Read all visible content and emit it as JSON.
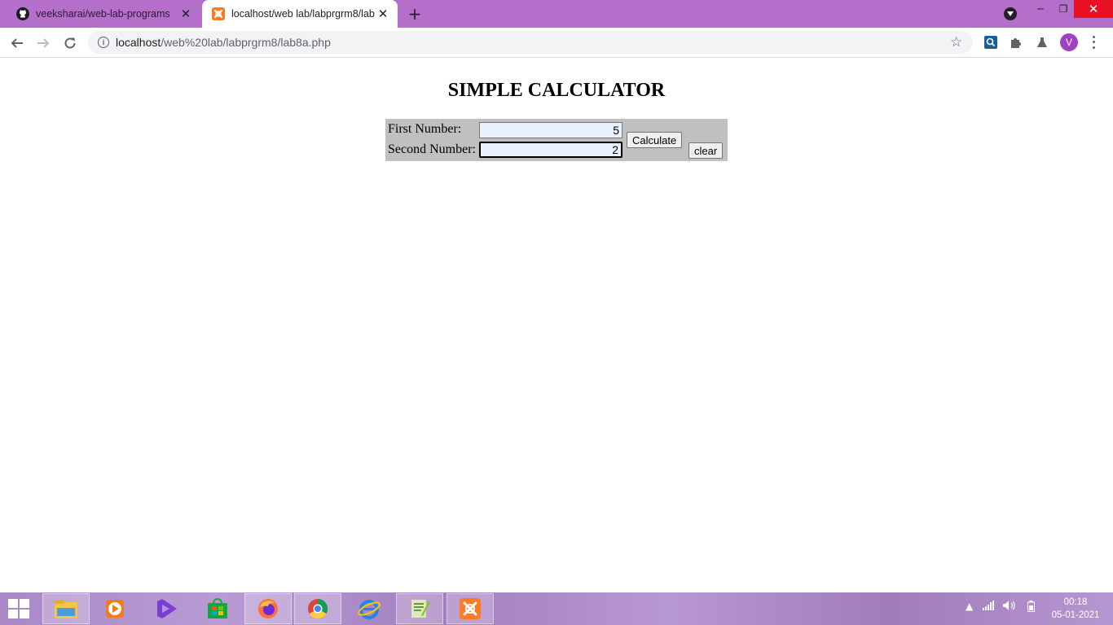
{
  "browser": {
    "tabs": [
      {
        "title": "veeksharai/web-lab-programs",
        "active": false,
        "icon": "github-icon"
      },
      {
        "title": "localhost/web lab/labprgrm8/lab8a.php",
        "active": true,
        "icon": "xampp-icon"
      }
    ],
    "url_host": "localhost",
    "url_path": "/web%20lab/labprgrm8/lab8a.php",
    "profile_initial": "V",
    "colors": {
      "tab_strip": "#b36fca",
      "profile": "#a142c4",
      "close_button": "#e81123"
    }
  },
  "page": {
    "title": "SIMPLE CALCULATOR",
    "form": {
      "first_label": "First Number:",
      "first_value": "5",
      "second_label": "Second Number:",
      "second_value": "2",
      "calculate_label": "Calculate",
      "clear_label": "clear",
      "background": "#c0c0c0"
    }
  },
  "taskbar": {
    "apps": [
      "file-explorer-icon",
      "media-player-icon",
      "visual-studio-icon",
      "store-icon",
      "firefox-icon",
      "chrome-icon",
      "internet-explorer-icon",
      "notepad-plus-plus-icon",
      "xampp-icon"
    ],
    "time": "00:18",
    "date": "05-01-2021"
  }
}
